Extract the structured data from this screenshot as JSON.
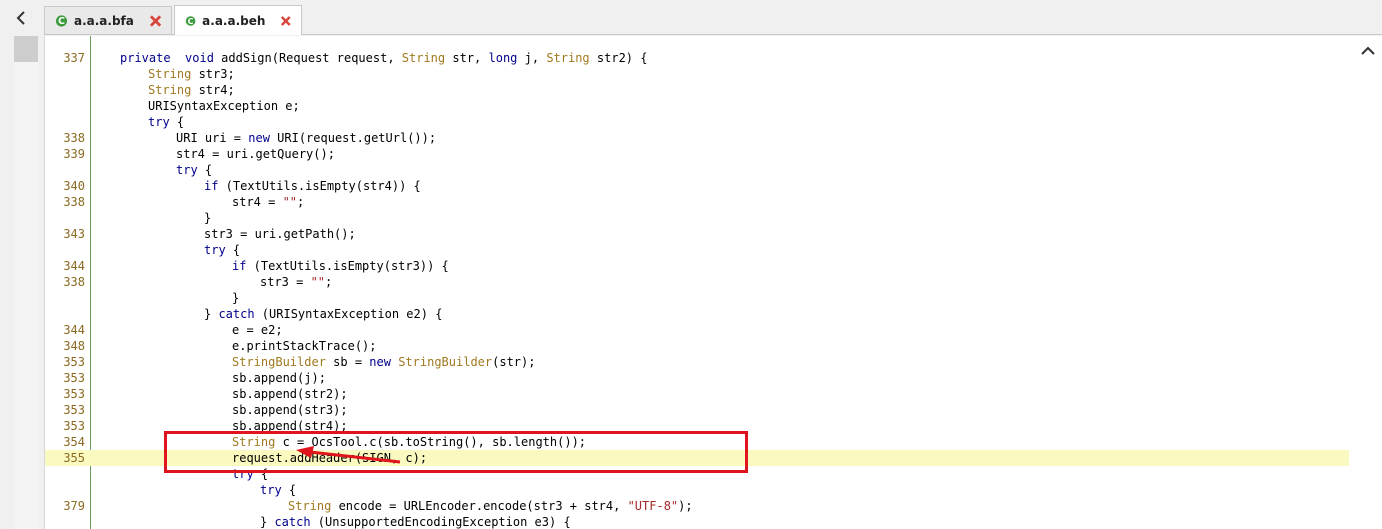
{
  "tabs": [
    {
      "label": "a.a.a.bfa",
      "active": false
    },
    {
      "label": "a.a.a.beh",
      "active": true
    }
  ],
  "icons": {
    "scroll_left": "chevron-left-icon",
    "tab_class": "class-c-icon",
    "tab_close": "close-x-icon",
    "scroll_up": "chevron-up-icon"
  },
  "colors": {
    "keyword": "#00008b",
    "type": "#a0781e",
    "string": "#a52a2a",
    "line_number": "#8a6a20",
    "highlight": "#fafac0",
    "annotation": "#e0141c"
  },
  "lines": [
    {
      "num": "337",
      "indent": 1,
      "tokens": [
        [
          "kw",
          "private"
        ],
        [
          "",
          "  "
        ],
        [
          "kw",
          "void"
        ],
        [
          "",
          " addSign(Request request, "
        ],
        [
          "ty",
          "String"
        ],
        [
          "",
          " str, "
        ],
        [
          "kw",
          "long"
        ],
        [
          "",
          " j, "
        ],
        [
          "ty",
          "String"
        ],
        [
          "",
          " str2) {"
        ]
      ]
    },
    {
      "num": "",
      "indent": 2,
      "tokens": [
        [
          "ty",
          "String"
        ],
        [
          "",
          " str3;"
        ]
      ]
    },
    {
      "num": "",
      "indent": 2,
      "tokens": [
        [
          "ty",
          "String"
        ],
        [
          "",
          " str4;"
        ]
      ]
    },
    {
      "num": "",
      "indent": 2,
      "tokens": [
        [
          "",
          "URISyntaxException e;"
        ]
      ]
    },
    {
      "num": "",
      "indent": 2,
      "tokens": [
        [
          "kw",
          "try"
        ],
        [
          "",
          " {"
        ]
      ]
    },
    {
      "num": "338",
      "indent": 3,
      "tokens": [
        [
          "",
          "URI uri = "
        ],
        [
          "kw",
          "new"
        ],
        [
          "",
          " URI(request.getUrl());"
        ]
      ]
    },
    {
      "num": "339",
      "indent": 3,
      "tokens": [
        [
          "",
          "str4 = uri.getQuery();"
        ]
      ]
    },
    {
      "num": "",
      "indent": 3,
      "tokens": [
        [
          "kw",
          "try"
        ],
        [
          "",
          " {"
        ]
      ]
    },
    {
      "num": "340",
      "indent": 4,
      "tokens": [
        [
          "kw",
          "if"
        ],
        [
          "",
          " (TextUtils.isEmpty(str4)) {"
        ]
      ]
    },
    {
      "num": "338",
      "indent": 5,
      "tokens": [
        [
          "",
          "str4 = "
        ],
        [
          "st",
          "\"\""
        ],
        [
          "",
          ";"
        ]
      ]
    },
    {
      "num": "",
      "indent": 4,
      "tokens": [
        [
          "",
          "}"
        ]
      ]
    },
    {
      "num": "343",
      "indent": 4,
      "tokens": [
        [
          "",
          "str3 = uri.getPath();"
        ]
      ]
    },
    {
      "num": "",
      "indent": 4,
      "tokens": [
        [
          "kw",
          "try"
        ],
        [
          "",
          " {"
        ]
      ]
    },
    {
      "num": "344",
      "indent": 5,
      "tokens": [
        [
          "kw",
          "if"
        ],
        [
          "",
          " (TextUtils.isEmpty(str3)) {"
        ]
      ]
    },
    {
      "num": "338",
      "indent": 6,
      "tokens": [
        [
          "",
          "str3 = "
        ],
        [
          "st",
          "\"\""
        ],
        [
          "",
          ";"
        ]
      ]
    },
    {
      "num": "",
      "indent": 5,
      "tokens": [
        [
          "",
          "}"
        ]
      ]
    },
    {
      "num": "",
      "indent": 4,
      "tokens": [
        [
          "",
          "} "
        ],
        [
          "kw",
          "catch"
        ],
        [
          "",
          " (URISyntaxException e2) {"
        ]
      ]
    },
    {
      "num": "344",
      "indent": 5,
      "tokens": [
        [
          "",
          "e = e2;"
        ]
      ]
    },
    {
      "num": "348",
      "indent": 5,
      "tokens": [
        [
          "",
          "e.printStackTrace();"
        ]
      ]
    },
    {
      "num": "353",
      "indent": 5,
      "tokens": [
        [
          "ty",
          "StringBuilder"
        ],
        [
          "",
          " sb = "
        ],
        [
          "kw",
          "new"
        ],
        [
          "",
          " "
        ],
        [
          "ty",
          "StringBuilder"
        ],
        [
          "",
          "(str);"
        ]
      ]
    },
    {
      "num": "353",
      "indent": 5,
      "tokens": [
        [
          "",
          "sb.append(j);"
        ]
      ]
    },
    {
      "num": "353",
      "indent": 5,
      "tokens": [
        [
          "",
          "sb.append(str2);"
        ]
      ]
    },
    {
      "num": "353",
      "indent": 5,
      "tokens": [
        [
          "",
          "sb.append(str3);"
        ]
      ]
    },
    {
      "num": "353",
      "indent": 5,
      "tokens": [
        [
          "",
          "sb.append(str4);"
        ]
      ]
    },
    {
      "num": "354",
      "indent": 5,
      "tokens": [
        [
          "ty",
          "String"
        ],
        [
          "",
          " c = OcsTool.c(sb.toString(), sb.length());"
        ]
      ]
    },
    {
      "num": "355",
      "indent": 5,
      "highlight": true,
      "tokens": [
        [
          "",
          "request.addHeader(SIGN, c);"
        ]
      ]
    },
    {
      "num": "",
      "indent": 5,
      "tokens": [
        [
          "kw",
          "try"
        ],
        [
          "",
          " {"
        ]
      ]
    },
    {
      "num": "",
      "indent": 6,
      "tokens": [
        [
          "kw",
          "try"
        ],
        [
          "",
          " {"
        ]
      ]
    },
    {
      "num": "379",
      "indent": 7,
      "tokens": [
        [
          "ty",
          "String"
        ],
        [
          "",
          " encode = URLEncoder.encode(str3 + str4, "
        ],
        [
          "st",
          "\"UTF-8\""
        ],
        [
          "",
          ");"
        ]
      ]
    },
    {
      "num": "",
      "indent": 6,
      "tokens": [
        [
          "",
          "} "
        ],
        [
          "kw",
          "catch"
        ],
        [
          "",
          " (UnsupportedEncodingException e3) {"
        ]
      ]
    }
  ]
}
